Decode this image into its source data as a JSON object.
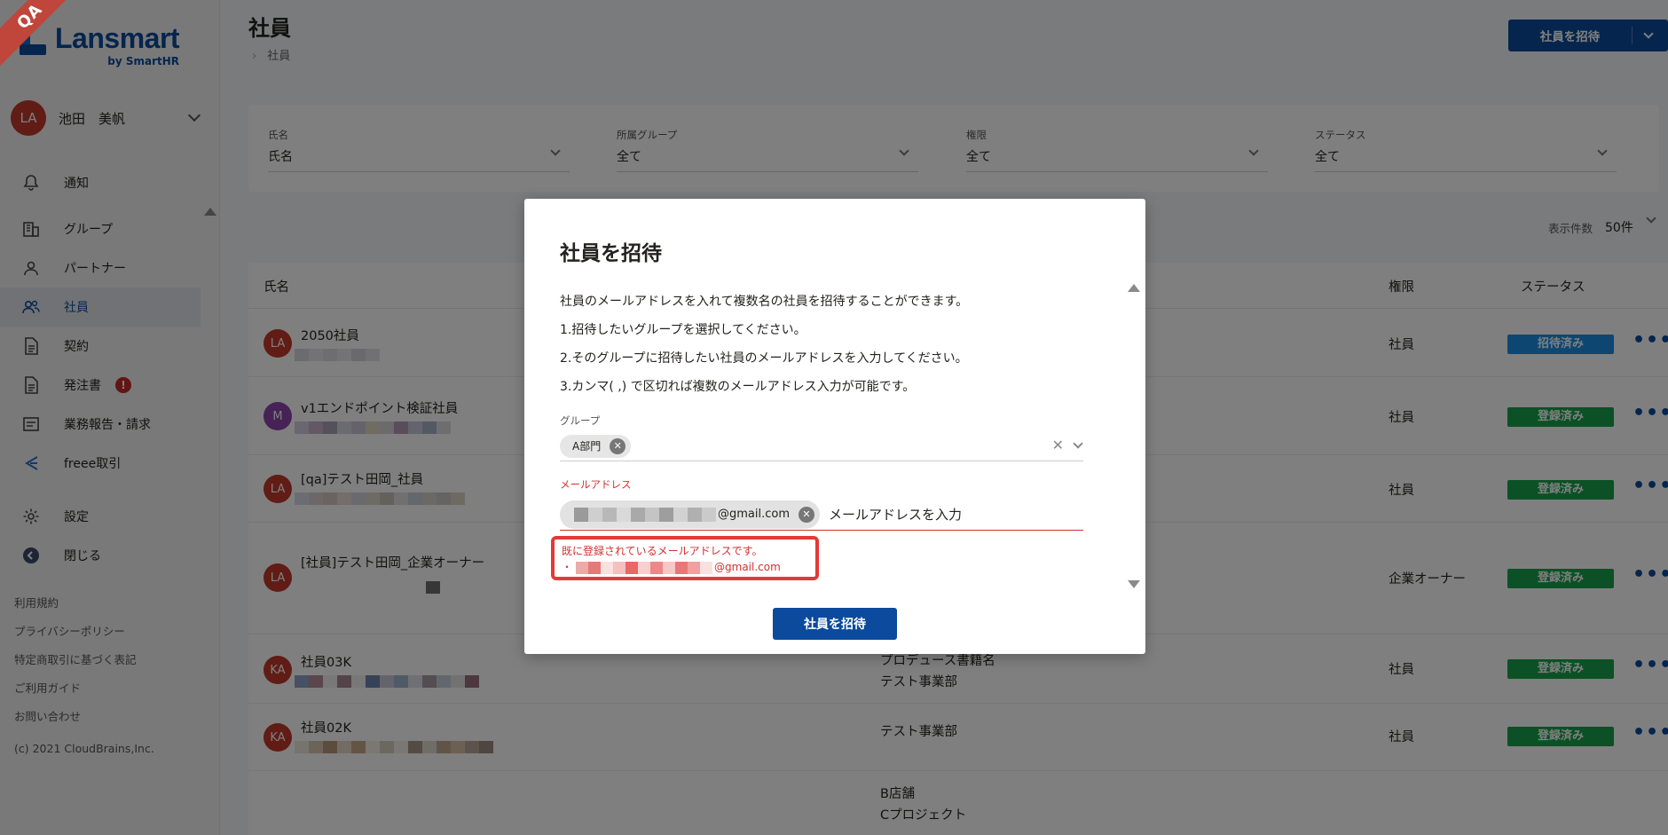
{
  "sidebar": {
    "qa_label": "QA",
    "logo_text": "Lansmart",
    "logo_sub": "by SmartHR",
    "user": {
      "initials": "LA",
      "name": "池田　美帆"
    },
    "nav": [
      {
        "label": "通知",
        "icon": "bell-icon"
      },
      {
        "label": "グループ",
        "icon": "building-icon"
      },
      {
        "label": "パートナー",
        "icon": "person-icon"
      },
      {
        "label": "社員",
        "icon": "people-icon"
      },
      {
        "label": "契約",
        "icon": "document-icon"
      },
      {
        "label": "発注書",
        "icon": "document-icon",
        "badge": "!"
      },
      {
        "label": "業務報告・請求",
        "icon": "folder-icon"
      },
      {
        "label": "freee取引",
        "icon": "freee-icon"
      },
      {
        "label": "設定",
        "icon": "gear-icon"
      },
      {
        "label": "閉じる",
        "icon": "collapse-icon"
      }
    ],
    "footer": [
      "利用規約",
      "プライバシーポリシー",
      "特定商取引に基づく表記",
      "ご利用ガイド",
      "お問い合わせ"
    ],
    "copyright": "(c) 2021 CloudBrains,Inc."
  },
  "header": {
    "title": "社員",
    "breadcrumb": "社員",
    "invite_button": "社員を招待"
  },
  "filters": [
    {
      "label": "氏名",
      "value": "氏名"
    },
    {
      "label": "所属グループ",
      "value": "全て"
    },
    {
      "label": "権限",
      "value": "全て"
    },
    {
      "label": "ステータス",
      "value": "全て"
    }
  ],
  "per_page": {
    "label": "表示件数",
    "value": "50件"
  },
  "table": {
    "headers": {
      "name": "氏名",
      "role": "権限",
      "status": "ステータス"
    },
    "rows": [
      {
        "initials": "LA",
        "name": "2050社員",
        "group": "",
        "role": "社員",
        "status": "招待済み"
      },
      {
        "initials": "M",
        "name": "v1エンドポイント検証社員",
        "group": "",
        "role": "社員",
        "status": "登録済み"
      },
      {
        "initials": "LA",
        "name": "[qa]テスト田岡_社員",
        "group": "",
        "role": "社員",
        "status": "登録済み"
      },
      {
        "initials": "LA",
        "name": "[社員]テスト田岡_企業オーナー",
        "group": "",
        "role": "企業オーナー",
        "status": "登録済み"
      },
      {
        "initials": "KA",
        "name": "社員03K",
        "group_lines": [
          "プロデュース書籍名",
          "テスト事業部"
        ],
        "role": "社員",
        "status": "登録済み"
      },
      {
        "initials": "KA",
        "name": "社員02K",
        "group_lines": [
          "テスト事業部"
        ],
        "role": "社員",
        "status": "登録済み"
      },
      {
        "initials": "",
        "name": "",
        "group_lines": [
          "B店舗",
          "Cプロジェクト"
        ],
        "role": "",
        "status": ""
      }
    ]
  },
  "modal": {
    "title": "社員を招待",
    "description": [
      "社員のメールアドレスを入れて複数名の社員を招待することができます。",
      "1.招待したいグループを選択してください。",
      "2.そのグループに招待したい社員のメールアドレスを入力してください。",
      "3.カンマ( ,) で区切れば複数のメールアドレス入力が可能です。"
    ],
    "group_label": "グループ",
    "group_chip": "A部門",
    "email_label": "メールアドレス",
    "email_chip_domain": "@gmail.com",
    "email_placeholder": "メールアドレスを入力",
    "error_title": "既に登録されているメールアドレスです。",
    "error_item_prefix": "・",
    "error_item_domain": "@gmail.com",
    "submit": "社員を招待"
  },
  "colors": {
    "brand": "#0b4a9c",
    "error": "#d32f2f",
    "status_registered": "#16a34a",
    "status_invited": "#1a8fe3"
  }
}
